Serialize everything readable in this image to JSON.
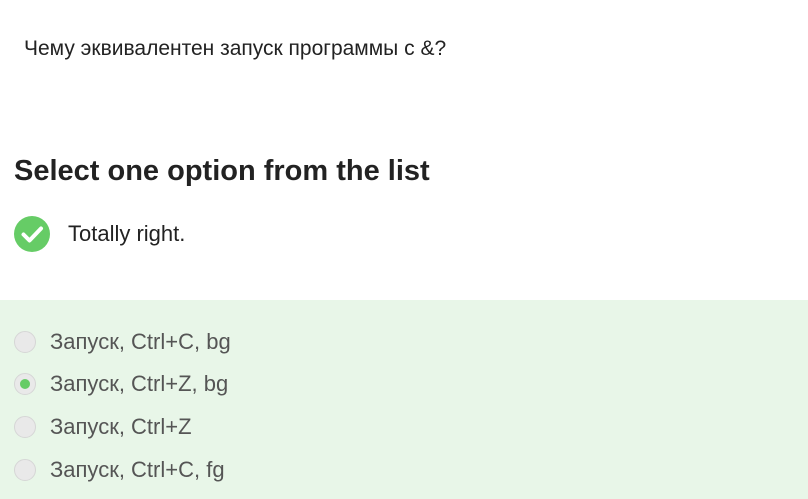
{
  "question": {
    "text": "Чему эквивалентен запуск программы с &?"
  },
  "section": {
    "heading": "Select one option from the list"
  },
  "feedback": {
    "icon": "check-circle-icon",
    "text": "Totally right.",
    "color": "#66cc66"
  },
  "options": {
    "background": "#e8f6e8",
    "items": [
      {
        "label": "Запуск, Ctrl+C, bg",
        "selected": false
      },
      {
        "label": "Запуск, Ctrl+Z, bg",
        "selected": true
      },
      {
        "label": "Запуск, Ctrl+Z",
        "selected": false
      },
      {
        "label": "Запуск, Ctrl+C, fg",
        "selected": false
      }
    ]
  }
}
